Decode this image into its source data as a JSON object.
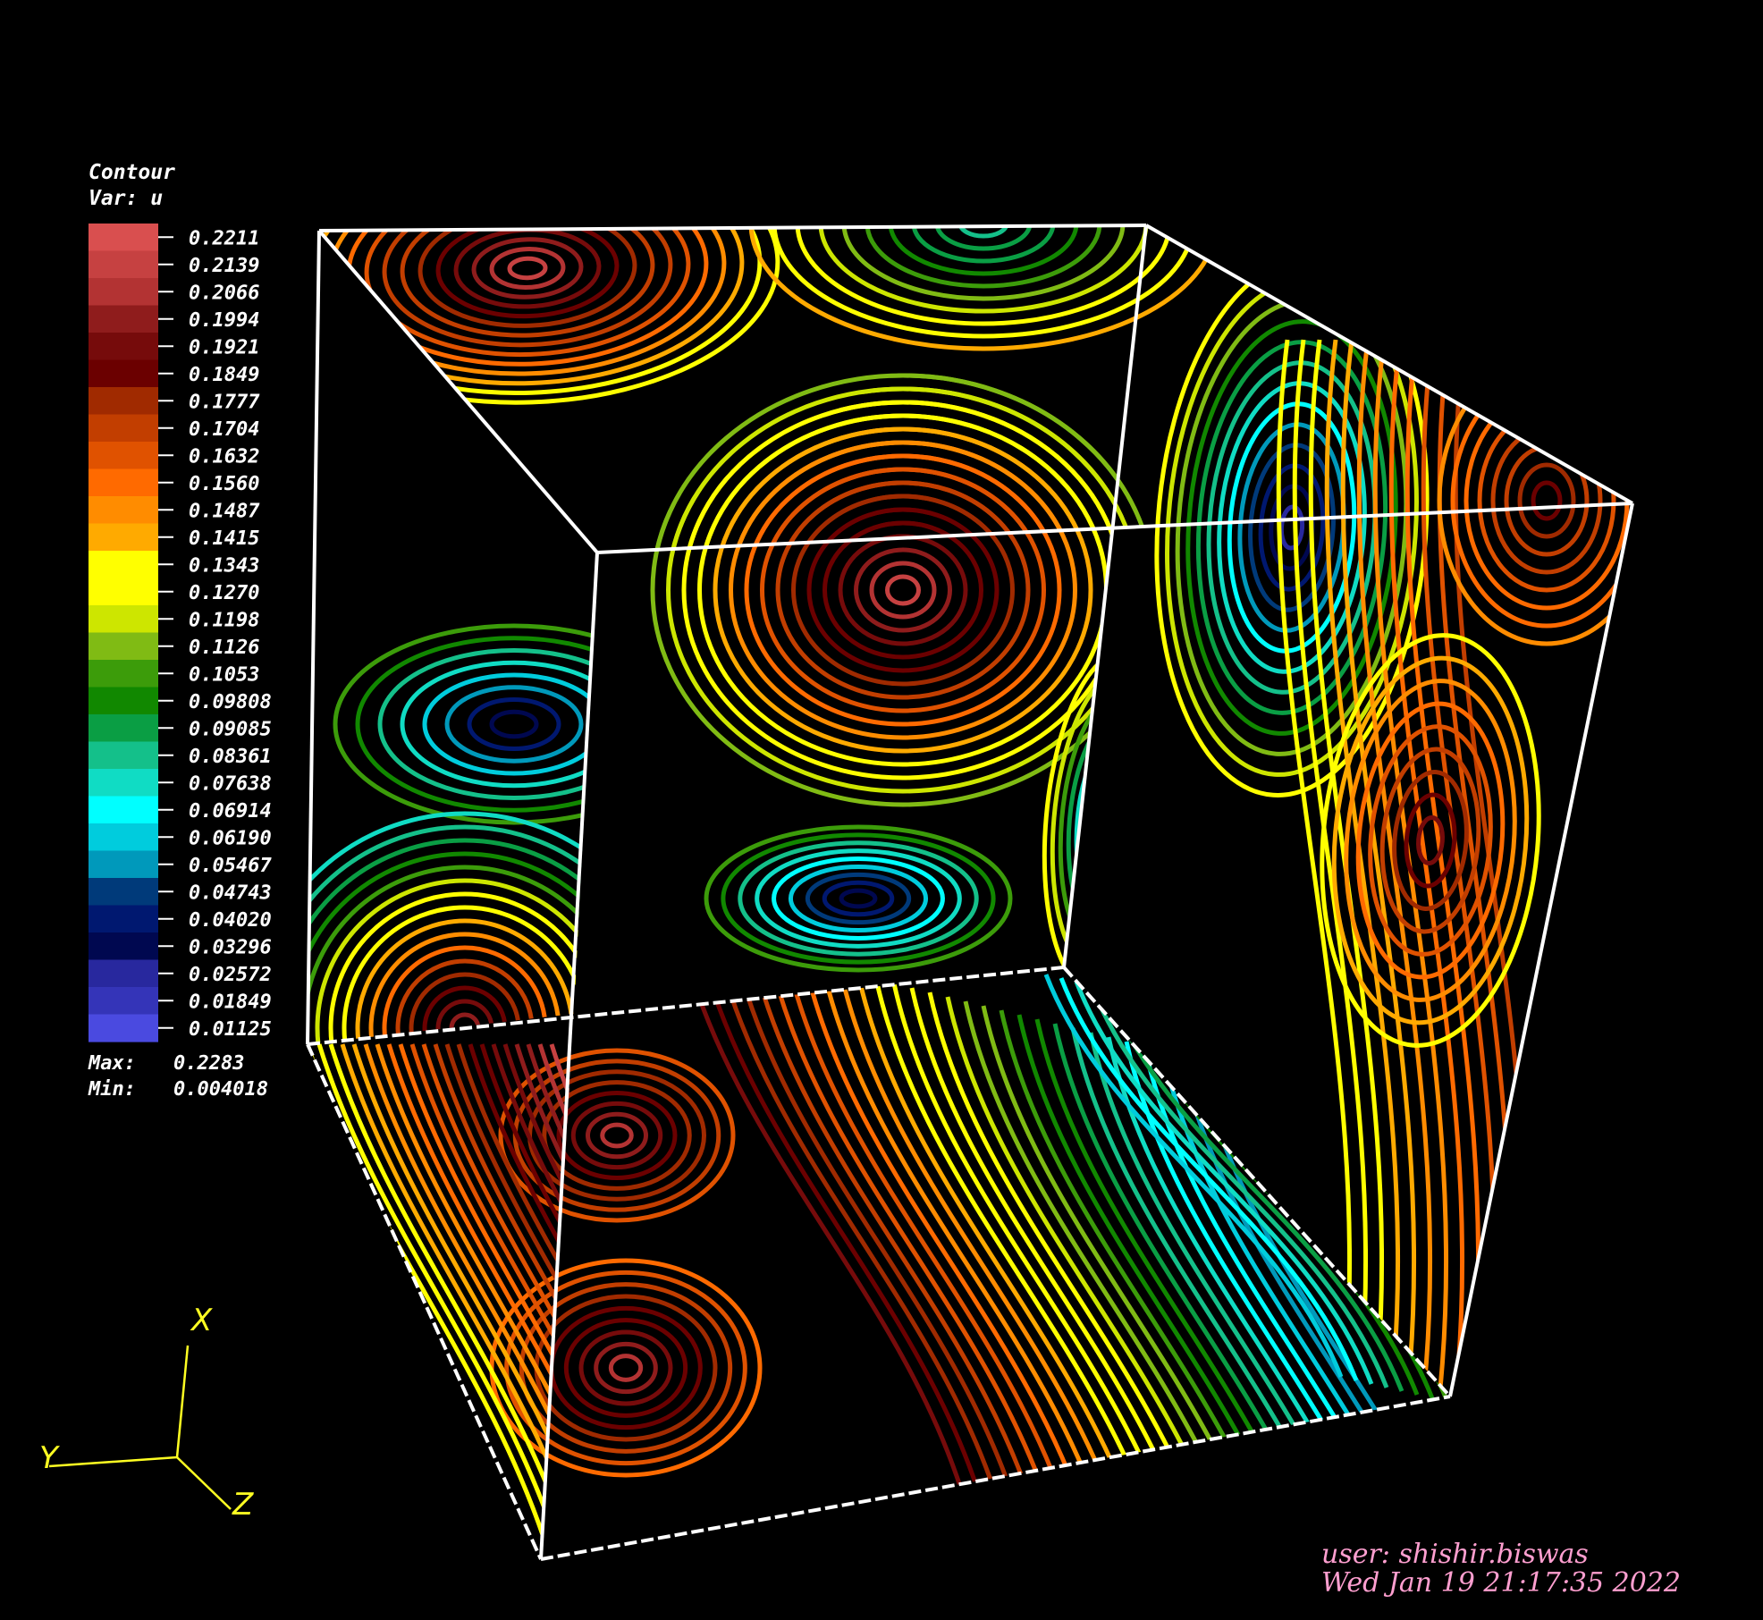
{
  "legend": {
    "title": "Contour",
    "var_label": "Var: u",
    "max_label": "Max:",
    "max_value": "0.2283",
    "min_label": "Min:",
    "min_value": "0.004018"
  },
  "chart_data": {
    "type": "contour",
    "variable": "u",
    "max": 0.2283,
    "min": 0.004018,
    "levels": [
      {
        "label": "0.2211",
        "color": "#d94f4f"
      },
      {
        "label": "0.2139",
        "color": "#c64141"
      },
      {
        "label": "0.2066",
        "color": "#b33333"
      },
      {
        "label": "0.1994",
        "color": "#8f1c1c"
      },
      {
        "label": "0.1921",
        "color": "#760b0b"
      },
      {
        "label": "0.1849",
        "color": "#6b0000"
      },
      {
        "label": "0.1777",
        "color": "#a02a00"
      },
      {
        "label": "0.1704",
        "color": "#c23e00"
      },
      {
        "label": "0.1632",
        "color": "#e05200"
      },
      {
        "label": "0.1560",
        "color": "#ff6a00"
      },
      {
        "label": "0.1487",
        "color": "#ff8c00"
      },
      {
        "label": "0.1415",
        "color": "#ffaa00"
      },
      {
        "label": "0.1343",
        "color": "#ffff00"
      },
      {
        "label": "0.1270",
        "color": "#ffff00"
      },
      {
        "label": "0.1198",
        "color": "#cde600"
      },
      {
        "label": "0.1126",
        "color": "#80bb14"
      },
      {
        "label": "0.1053",
        "color": "#3c9c0a"
      },
      {
        "label": "0.09808",
        "color": "#118800"
      },
      {
        "label": "0.09085",
        "color": "#0a9e44"
      },
      {
        "label": "0.08361",
        "color": "#14c08a"
      },
      {
        "label": "0.07638",
        "color": "#10dcc4"
      },
      {
        "label": "0.06914",
        "color": "#00ffff"
      },
      {
        "label": "0.06190",
        "color": "#00ccdd"
      },
      {
        "label": "0.05467",
        "color": "#0099bb"
      },
      {
        "label": "0.04743",
        "color": "#003a7a"
      },
      {
        "label": "0.04020",
        "color": "#001870"
      },
      {
        "label": "0.03296",
        "color": "#000850"
      },
      {
        "label": "0.02572",
        "color": "#28289e"
      },
      {
        "label": "0.01849",
        "color": "#3434b8"
      },
      {
        "label": "0.01125",
        "color": "#4a4ae0"
      }
    ]
  },
  "triad": {
    "x": "X",
    "y": "Y",
    "z": "Z"
  },
  "footer": {
    "user": "user: shishir.biswas",
    "timestamp": "Wed Jan 19 21:17:35 2022"
  },
  "colors": {
    "background": "#000000",
    "box_edge": "#ffffff",
    "triad": "#ffff22",
    "footer": "#ff9fd0"
  }
}
